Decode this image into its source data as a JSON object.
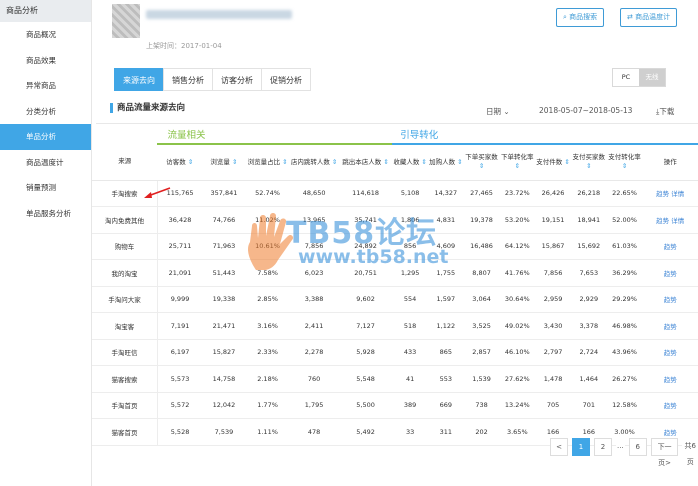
{
  "sidebar": {
    "header": "商品分析",
    "items": [
      "商品概况",
      "商品效果",
      "异常商品",
      "分类分析",
      "单品分析",
      "商品温度计",
      "销量预测",
      "单品服务分析"
    ],
    "active_index": 4
  },
  "top": {
    "date_line": "上架时间：2017-01-04",
    "btn_search": "商品搜索",
    "btn_thermo": "商品温度计"
  },
  "tabs": [
    "来源去向",
    "销售分析",
    "访客分析",
    "促销分析"
  ],
  "pc": {
    "pc": "PC",
    "wireless": "无线"
  },
  "section": {
    "title": "商品流量来源去向",
    "date_label": "日期",
    "date_range": "2018-05-07~2018-05-13",
    "download": "下载"
  },
  "groups": {
    "traffic": "流量相关",
    "conversion": "引导转化"
  },
  "columns": [
    "来源",
    "访客数",
    "浏览量",
    "浏览量占比",
    "店内跳转人数",
    "跳出本店人数",
    "收藏人数",
    "加购人数",
    "下单买家数",
    "下单转化率",
    "支付件数",
    "支付买家数",
    "支付转化率",
    "操作"
  ],
  "rows": [
    [
      "手淘搜索",
      "115,765",
      "357,841",
      "52.74%",
      "48,650",
      "114,618",
      "5,108",
      "14,327",
      "27,465",
      "23.72%",
      "26,426",
      "26,218",
      "22.65%",
      "趋势",
      "详情"
    ],
    [
      "淘内免费其他",
      "36,428",
      "74,766",
      "11.02%",
      "13,965",
      "35,741",
      "1,806",
      "4,831",
      "19,378",
      "53.20%",
      "19,151",
      "18,941",
      "52.00%",
      "趋势",
      "详情"
    ],
    [
      "购物车",
      "25,711",
      "71,963",
      "10.61%",
      "7,856",
      "24,892",
      "856",
      "4,609",
      "16,486",
      "64.12%",
      "15,867",
      "15,692",
      "61.03%",
      "趋势",
      ""
    ],
    [
      "我的淘宝",
      "21,091",
      "51,443",
      "7.58%",
      "6,023",
      "20,751",
      "1,295",
      "1,755",
      "8,807",
      "41.76%",
      "7,856",
      "7,653",
      "36.29%",
      "趋势",
      ""
    ],
    [
      "手淘问大家",
      "9,999",
      "19,338",
      "2.85%",
      "3,388",
      "9,602",
      "554",
      "1,597",
      "3,064",
      "30.64%",
      "2,959",
      "2,929",
      "29.29%",
      "趋势",
      ""
    ],
    [
      "淘宝客",
      "7,191",
      "21,471",
      "3.16%",
      "2,411",
      "7,127",
      "518",
      "1,122",
      "3,525",
      "49.02%",
      "3,430",
      "3,378",
      "46.98%",
      "趋势",
      ""
    ],
    [
      "手淘旺信",
      "6,197",
      "15,827",
      "2.33%",
      "2,278",
      "5,928",
      "433",
      "865",
      "2,857",
      "46.10%",
      "2,797",
      "2,724",
      "43.96%",
      "趋势",
      ""
    ],
    [
      "猫客搜索",
      "5,573",
      "14,758",
      "2.18%",
      "760",
      "5,548",
      "41",
      "553",
      "1,539",
      "27.62%",
      "1,478",
      "1,464",
      "26.27%",
      "趋势",
      ""
    ],
    [
      "手淘首页",
      "5,572",
      "12,042",
      "1.77%",
      "1,795",
      "5,500",
      "389",
      "669",
      "738",
      "13.24%",
      "705",
      "701",
      "12.58%",
      "趋势",
      ""
    ],
    [
      "猫客首页",
      "5,528",
      "7,539",
      "1.11%",
      "478",
      "5,492",
      "33",
      "311",
      "202",
      "3.65%",
      "166",
      "166",
      "3.00%",
      "趋势",
      ""
    ]
  ],
  "pager": {
    "prev": "<",
    "pages": [
      "1",
      "2",
      "...",
      "6"
    ],
    "next": "下一页>",
    "total": "共6页"
  },
  "watermark": {
    "line1": "TB58论坛",
    "line2": "www.tb58.net"
  }
}
